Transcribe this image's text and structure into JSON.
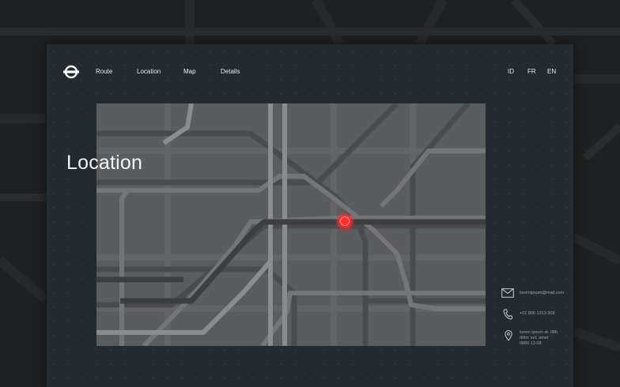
{
  "nav": {
    "logo_icon": "roundel-logo-icon",
    "items": [
      {
        "label": "Route"
      },
      {
        "label": "Location"
      },
      {
        "label": "Map"
      },
      {
        "label": "Details"
      }
    ]
  },
  "languages": [
    {
      "label": "ID"
    },
    {
      "label": "FR"
    },
    {
      "label": "EN"
    }
  ],
  "hero": {
    "title": "Location"
  },
  "map": {
    "pin_color": "#ff2a2a",
    "pin_icon": "location-marker-icon"
  },
  "contact": {
    "email": "loremipsum@mail.com",
    "phone": "+01 800 1313 008",
    "address_line1": "lorem ipsum st. 08b",
    "address_line2": "dolor set, amet",
    "address_line3": "0880 13 08",
    "icons": [
      "mail-icon",
      "phone-icon",
      "map-pin-icon"
    ]
  },
  "colors": {
    "background": "#1f2021",
    "card": "#232b30",
    "map": "#5b5c5e",
    "accent": "#ff2a2a"
  }
}
